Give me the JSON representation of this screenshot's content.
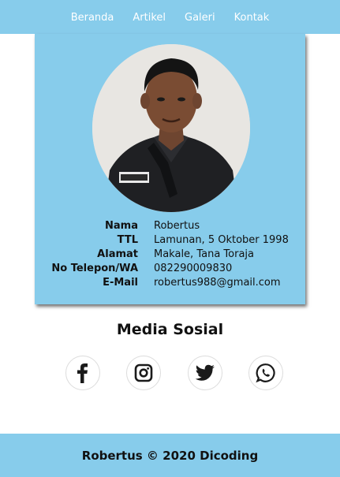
{
  "nav": {
    "items": [
      {
        "label": "Beranda"
      },
      {
        "label": "Artikel"
      },
      {
        "label": "Galeri"
      },
      {
        "label": "Kontak"
      }
    ]
  },
  "profile": {
    "rows": [
      {
        "label": "Nama",
        "value": "Robertus"
      },
      {
        "label": "TTL",
        "value": "Lamunan, 5 Oktober 1998"
      },
      {
        "label": "Alamat",
        "value": "Makale, Tana Toraja"
      },
      {
        "label": "No Telepon/WA",
        "value": "082290009830"
      },
      {
        "label": "E-Mail",
        "value": "robertus988@gmail.com"
      }
    ]
  },
  "social": {
    "title": "Media Sosial",
    "icons": [
      "facebook-icon",
      "instagram-icon",
      "twitter-icon",
      "whatsapp-icon"
    ]
  },
  "footer": {
    "text": "Robertus © 2020 Dicoding"
  },
  "colors": {
    "accent": "#87cceb",
    "text": "#111111",
    "nav_text": "#ffffff"
  }
}
